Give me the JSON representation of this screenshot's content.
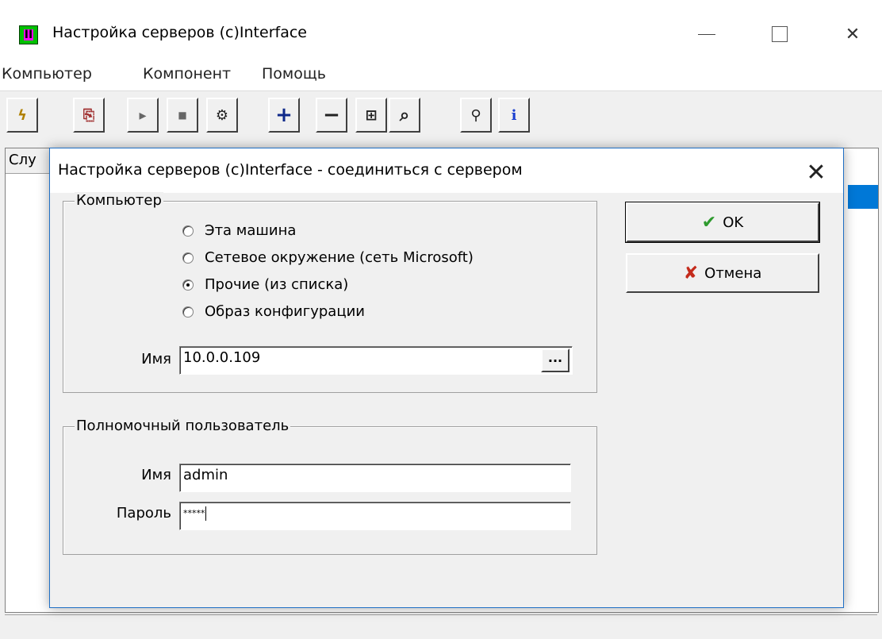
{
  "window": {
    "title": "Настройка серверов (c)Interface",
    "controls": {
      "minimize": "—",
      "maximize": "☐",
      "close": "✕"
    }
  },
  "menu": {
    "items": [
      "Компьютер",
      "Компонент",
      "Помощь"
    ]
  },
  "toolbar": {
    "buttons": [
      {
        "icon": "lightning-icon",
        "glyph": "ϟ"
      },
      {
        "icon": "export-icon",
        "glyph": "⎘"
      },
      {
        "icon": "play-icon",
        "glyph": "▸"
      },
      {
        "icon": "stop-icon",
        "glyph": "■"
      },
      {
        "icon": "config-icon",
        "glyph": "⚙"
      },
      {
        "icon": "plus-icon",
        "glyph": "+"
      },
      {
        "icon": "minus-icon",
        "glyph": "−"
      },
      {
        "icon": "properties-icon",
        "glyph": "⊞"
      },
      {
        "icon": "search-help-icon",
        "glyph": "⌕"
      },
      {
        "icon": "connect-icon",
        "glyph": "⚲"
      },
      {
        "icon": "info-icon",
        "glyph": "i"
      }
    ]
  },
  "list": {
    "column_header": "Слу"
  },
  "dialog": {
    "title": "Настройка серверов (c)Interface - соединиться с сервером",
    "close": "✕",
    "computer_group": {
      "legend": "Компьютер",
      "options": [
        {
          "label": "Эта машина",
          "checked": false
        },
        {
          "label": "Сетевое окружение (сеть Microsoft)",
          "checked": false
        },
        {
          "label": "Прочие  (из списка)",
          "checked": true
        },
        {
          "label": "Образ конфигурации",
          "checked": false
        }
      ],
      "name_label": "Имя",
      "name_value": "10.0.0.109",
      "browse_label": "..."
    },
    "user_group": {
      "legend": "Полномочный пользователь",
      "name_label": "Имя",
      "name_value": "admin",
      "password_label": "Пароль",
      "password_value": "*****"
    },
    "buttons": {
      "ok_label": "OK",
      "ok_icon": "✔",
      "cancel_label": "Отмена",
      "cancel_icon": "✘"
    }
  },
  "colors": {
    "accent": "#0078d7",
    "ok_green": "#2e9a2e",
    "cancel_red": "#c42b1c",
    "info_blue": "#1a3fd0"
  }
}
